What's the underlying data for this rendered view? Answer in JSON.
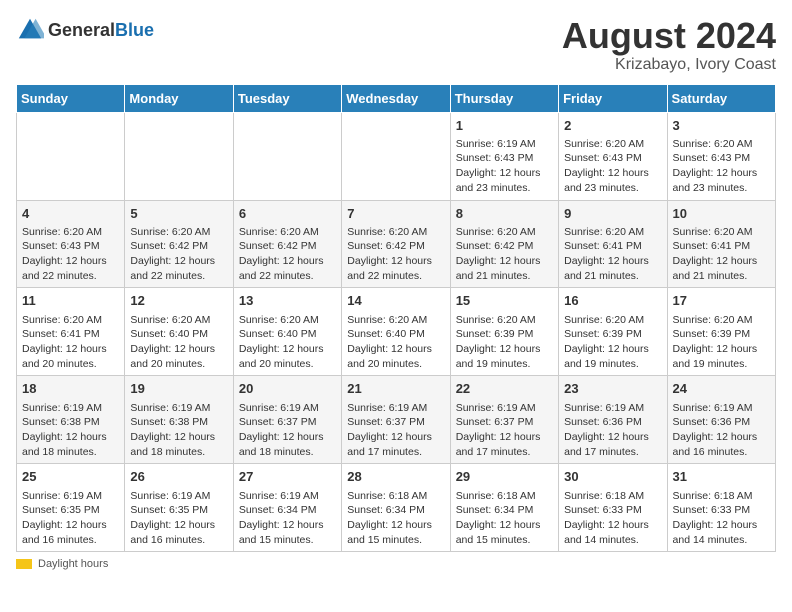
{
  "title": "August 2024",
  "subtitle": "Krizabayo, Ivory Coast",
  "logo": {
    "general": "General",
    "blue": "Blue"
  },
  "days_of_week": [
    "Sunday",
    "Monday",
    "Tuesday",
    "Wednesday",
    "Thursday",
    "Friday",
    "Saturday"
  ],
  "weeks": [
    [
      {
        "day": "",
        "info": ""
      },
      {
        "day": "",
        "info": ""
      },
      {
        "day": "",
        "info": ""
      },
      {
        "day": "",
        "info": ""
      },
      {
        "day": "1",
        "info": "Sunrise: 6:19 AM\nSunset: 6:43 PM\nDaylight: 12 hours\nand 23 minutes."
      },
      {
        "day": "2",
        "info": "Sunrise: 6:20 AM\nSunset: 6:43 PM\nDaylight: 12 hours\nand 23 minutes."
      },
      {
        "day": "3",
        "info": "Sunrise: 6:20 AM\nSunset: 6:43 PM\nDaylight: 12 hours\nand 23 minutes."
      }
    ],
    [
      {
        "day": "4",
        "info": "Sunrise: 6:20 AM\nSunset: 6:43 PM\nDaylight: 12 hours\nand 22 minutes."
      },
      {
        "day": "5",
        "info": "Sunrise: 6:20 AM\nSunset: 6:42 PM\nDaylight: 12 hours\nand 22 minutes."
      },
      {
        "day": "6",
        "info": "Sunrise: 6:20 AM\nSunset: 6:42 PM\nDaylight: 12 hours\nand 22 minutes."
      },
      {
        "day": "7",
        "info": "Sunrise: 6:20 AM\nSunset: 6:42 PM\nDaylight: 12 hours\nand 22 minutes."
      },
      {
        "day": "8",
        "info": "Sunrise: 6:20 AM\nSunset: 6:42 PM\nDaylight: 12 hours\nand 21 minutes."
      },
      {
        "day": "9",
        "info": "Sunrise: 6:20 AM\nSunset: 6:41 PM\nDaylight: 12 hours\nand 21 minutes."
      },
      {
        "day": "10",
        "info": "Sunrise: 6:20 AM\nSunset: 6:41 PM\nDaylight: 12 hours\nand 21 minutes."
      }
    ],
    [
      {
        "day": "11",
        "info": "Sunrise: 6:20 AM\nSunset: 6:41 PM\nDaylight: 12 hours\nand 20 minutes."
      },
      {
        "day": "12",
        "info": "Sunrise: 6:20 AM\nSunset: 6:40 PM\nDaylight: 12 hours\nand 20 minutes."
      },
      {
        "day": "13",
        "info": "Sunrise: 6:20 AM\nSunset: 6:40 PM\nDaylight: 12 hours\nand 20 minutes."
      },
      {
        "day": "14",
        "info": "Sunrise: 6:20 AM\nSunset: 6:40 PM\nDaylight: 12 hours\nand 20 minutes."
      },
      {
        "day": "15",
        "info": "Sunrise: 6:20 AM\nSunset: 6:39 PM\nDaylight: 12 hours\nand 19 minutes."
      },
      {
        "day": "16",
        "info": "Sunrise: 6:20 AM\nSunset: 6:39 PM\nDaylight: 12 hours\nand 19 minutes."
      },
      {
        "day": "17",
        "info": "Sunrise: 6:20 AM\nSunset: 6:39 PM\nDaylight: 12 hours\nand 19 minutes."
      }
    ],
    [
      {
        "day": "18",
        "info": "Sunrise: 6:19 AM\nSunset: 6:38 PM\nDaylight: 12 hours\nand 18 minutes."
      },
      {
        "day": "19",
        "info": "Sunrise: 6:19 AM\nSunset: 6:38 PM\nDaylight: 12 hours\nand 18 minutes."
      },
      {
        "day": "20",
        "info": "Sunrise: 6:19 AM\nSunset: 6:37 PM\nDaylight: 12 hours\nand 18 minutes."
      },
      {
        "day": "21",
        "info": "Sunrise: 6:19 AM\nSunset: 6:37 PM\nDaylight: 12 hours\nand 17 minutes."
      },
      {
        "day": "22",
        "info": "Sunrise: 6:19 AM\nSunset: 6:37 PM\nDaylight: 12 hours\nand 17 minutes."
      },
      {
        "day": "23",
        "info": "Sunrise: 6:19 AM\nSunset: 6:36 PM\nDaylight: 12 hours\nand 17 minutes."
      },
      {
        "day": "24",
        "info": "Sunrise: 6:19 AM\nSunset: 6:36 PM\nDaylight: 12 hours\nand 16 minutes."
      }
    ],
    [
      {
        "day": "25",
        "info": "Sunrise: 6:19 AM\nSunset: 6:35 PM\nDaylight: 12 hours\nand 16 minutes."
      },
      {
        "day": "26",
        "info": "Sunrise: 6:19 AM\nSunset: 6:35 PM\nDaylight: 12 hours\nand 16 minutes."
      },
      {
        "day": "27",
        "info": "Sunrise: 6:19 AM\nSunset: 6:34 PM\nDaylight: 12 hours\nand 15 minutes."
      },
      {
        "day": "28",
        "info": "Sunrise: 6:18 AM\nSunset: 6:34 PM\nDaylight: 12 hours\nand 15 minutes."
      },
      {
        "day": "29",
        "info": "Sunrise: 6:18 AM\nSunset: 6:34 PM\nDaylight: 12 hours\nand 15 minutes."
      },
      {
        "day": "30",
        "info": "Sunrise: 6:18 AM\nSunset: 6:33 PM\nDaylight: 12 hours\nand 14 minutes."
      },
      {
        "day": "31",
        "info": "Sunrise: 6:18 AM\nSunset: 6:33 PM\nDaylight: 12 hours\nand 14 minutes."
      }
    ]
  ],
  "footer": {
    "daylight_label": "Daylight hours"
  }
}
